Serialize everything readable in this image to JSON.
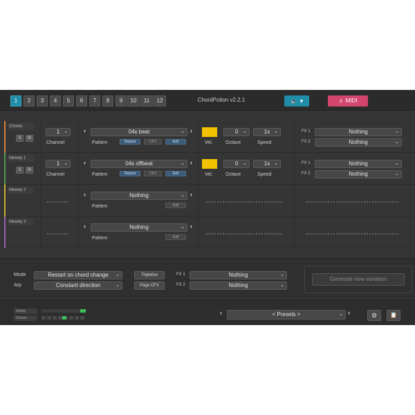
{
  "app": {
    "title": "ChordPotion v2.2.1",
    "tabs": [
      "1",
      "2",
      "3",
      "4",
      "5",
      "6",
      "7",
      "8",
      "9",
      "10",
      "11",
      "12"
    ],
    "active_tab": "1",
    "volume_icon": "🔈 ▾",
    "midi_label": "♬ MIDI"
  },
  "colors": {
    "accent": "#1f8da8",
    "midi": "#d2456e",
    "velocity": "#f2c200",
    "chords_stripe": "#d7823a",
    "melody1_stripe": "#4c9a4f",
    "melody2_stripe": "#c9b12b",
    "melody3_stripe": "#9a5fb0"
  },
  "tracks": [
    {
      "name": "Chords",
      "solo": "S",
      "mute": "M",
      "channel": "1",
      "channel_label": "Channel",
      "pattern": "04s beat",
      "pattern_label": "Pattern",
      "repeat": "Repeat",
      "cfx": "CFX",
      "edit": "Edit",
      "vel_label": "Vel.",
      "octave": "0",
      "octave_label": "Octave",
      "speed": "1x",
      "speed_label": "Speed",
      "fx1_label": "FX 1",
      "fx1": "Nothing",
      "fx2_label": "FX 2",
      "fx2": "Nothing"
    },
    {
      "name": "Melody 1",
      "solo": "S",
      "mute": "M",
      "channel": "1",
      "channel_label": "Channel",
      "pattern": "04s offbeat",
      "pattern_label": "Pattern",
      "repeat": "Repeat",
      "cfx": "CFX",
      "edit": "Edit",
      "vel_label": "Vel.",
      "octave": "0",
      "octave_label": "Octave",
      "speed": "1x",
      "speed_label": "Speed",
      "fx1_label": "FX 1",
      "fx1": "Nothing",
      "fx2_label": "FX 2",
      "fx2": "Nothing"
    },
    {
      "name": "Melody 2",
      "pattern": "Nothing",
      "pattern_label": "Pattern",
      "edit": "Edit"
    },
    {
      "name": "Melody 3",
      "pattern": "Nothing",
      "pattern_label": "Pattern",
      "edit": "Edit"
    }
  ],
  "settings": {
    "mode_label": "Mode",
    "mode": "Restart on chord change",
    "arp_label": "Arp",
    "arp": "Constant direction",
    "tripletize": "Tripletize",
    "page_cfx": "Page CFX",
    "fx1_label": "FX 1",
    "fx1": "Nothing",
    "fx2_label": "FX 2",
    "fx2": "Nothing",
    "generate": "Generate new variation"
  },
  "footer": {
    "swing_label": "Swing",
    "octave_label": "Octave",
    "presets": "< Presets >",
    "gear_icon": "⚙",
    "clipboard_icon": "📋"
  }
}
